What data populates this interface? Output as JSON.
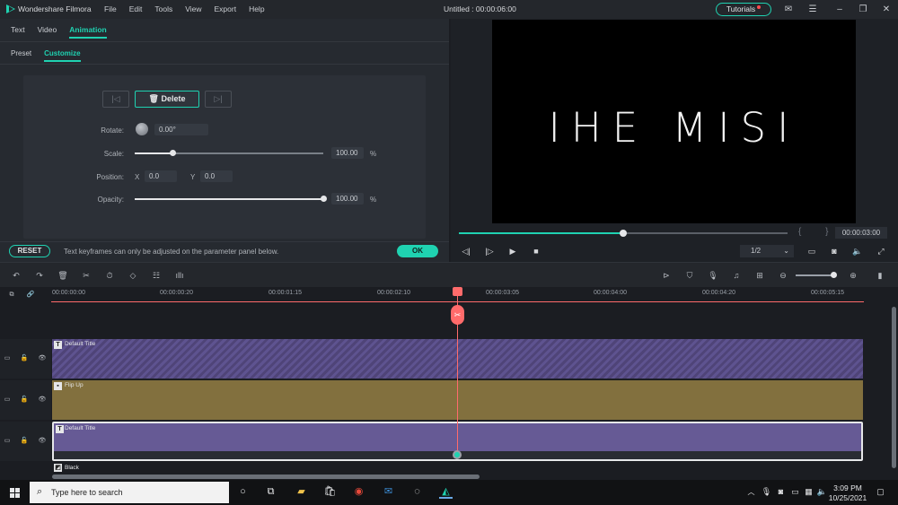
{
  "app": {
    "name": "Wondershare Filmora",
    "menu": [
      "File",
      "Edit",
      "Tools",
      "View",
      "Export",
      "Help"
    ],
    "project_title": "Untitled : 00:00:06:00",
    "tutorials_label": "Tutorials"
  },
  "left_panel": {
    "tabs": [
      "Text",
      "Video",
      "Animation"
    ],
    "active_tab": "Animation",
    "subtabs": [
      "Preset",
      "Customize"
    ],
    "active_subtab": "Customize",
    "keyframe": {
      "delete_label": "Delete"
    },
    "params": {
      "rotate_label": "Rotate:",
      "rotate_value": "0.00°",
      "scale_label": "Scale:",
      "scale_value": "100.00",
      "scale_unit": "%",
      "scale_level": 0.2,
      "position_label": "Position:",
      "x_label": "X",
      "x_value": "0.0",
      "y_label": "Y",
      "y_value": "0.0",
      "opacity_label": "Opacity:",
      "opacity_value": "100.00",
      "opacity_unit": "%",
      "opacity_level": 1.0
    },
    "reset_label": "RESET",
    "hint": "Text keyframes can only be adjusted on the parameter panel below.",
    "ok_label": "OK"
  },
  "preview": {
    "title_text": "IHE MISI",
    "progress": 0.5,
    "timecode": "00:00:03:00",
    "ratio": "1/2"
  },
  "timeline": {
    "ticks": [
      "00:00:00:00",
      "00:00:00:20",
      "00:00:01:15",
      "00:00:02:10",
      "00:00:03:05",
      "00:00:04:00",
      "00:00:04:20",
      "00:00:05:15"
    ],
    "tracks": [
      {
        "label": "Default Title",
        "color": "#5a4e86",
        "pattern": "striped",
        "icon": "TT"
      },
      {
        "label": "Flip Up",
        "color": "#82703e",
        "pattern": "solid",
        "icon": "■"
      },
      {
        "label": "Default Title",
        "color": "#665a95",
        "pattern": "solid",
        "icon": "T"
      },
      {
        "label": "Black",
        "color": "#1b1d22",
        "pattern": "solid",
        "icon": "◩"
      }
    ]
  },
  "taskbar": {
    "search_placeholder": "Type here to search",
    "time": "3:09 PM",
    "date": "10/25/2021"
  }
}
